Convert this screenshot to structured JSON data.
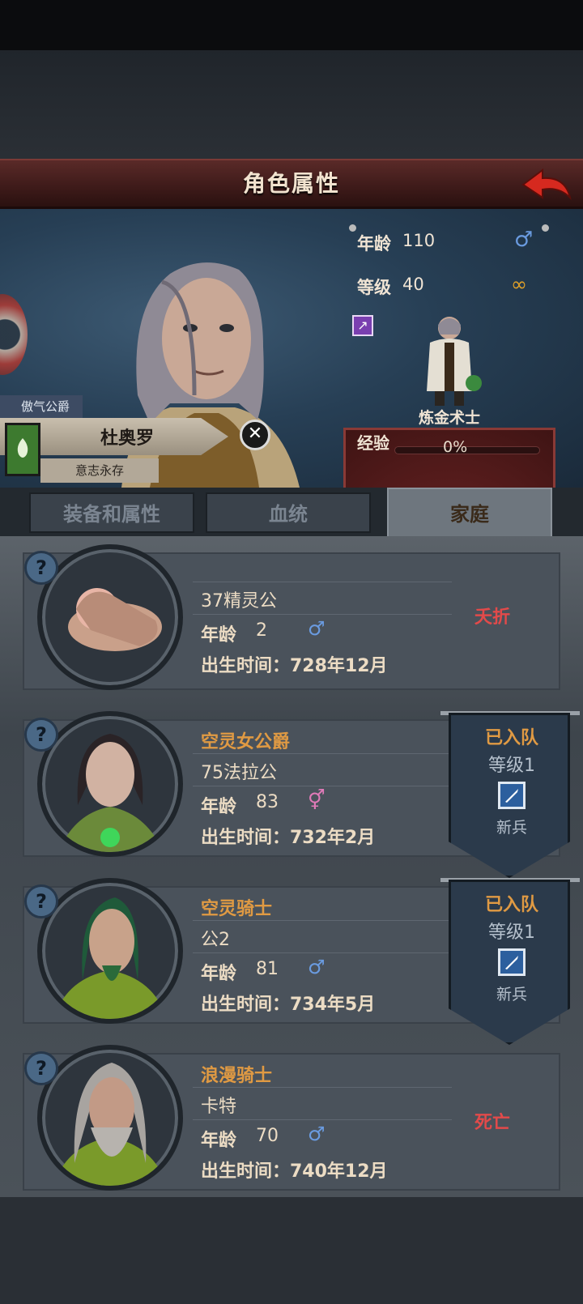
{
  "header": {
    "title": "角色属性"
  },
  "hero": {
    "title": "傲气公爵",
    "name": "杜奥罗",
    "motto": "意志永存"
  },
  "stats": {
    "age_label": "年龄",
    "age": "110",
    "level_label": "等级",
    "level": "40",
    "class_name": "炼金术士",
    "exp_label": "经验",
    "exp": "0%",
    "exp_fraction": 0
  },
  "tabs": [
    {
      "label": "装备和属性"
    },
    {
      "label": "血统"
    },
    {
      "label": "家庭"
    }
  ],
  "members": [
    {
      "title": "",
      "name": "37精灵公",
      "age_label": "年龄",
      "age": "2",
      "gender": "♂",
      "birth": "出生时间：728年12月",
      "status": "夭折"
    },
    {
      "title": "空灵女公爵",
      "name": "75法拉公",
      "age_label": "年龄",
      "age": "83",
      "gender": "⚥",
      "birth": "出生时间：732年2月",
      "pennant": {
        "joined": "已入队",
        "level": "等级1",
        "rank": "新兵"
      }
    },
    {
      "title": "空灵骑士",
      "name": "公2",
      "age_label": "年龄",
      "age": "81",
      "gender": "♂",
      "birth": "出生时间：734年5月",
      "pennant": {
        "joined": "已入队",
        "level": "等级1",
        "rank": "新兵"
      }
    },
    {
      "title": "浪漫骑士",
      "name": "卡特",
      "age_label": "年龄",
      "age": "70",
      "gender": "♂",
      "birth": "出生时间：740年12月",
      "status": "死亡"
    }
  ],
  "colors": {
    "header": "#4a2220",
    "panel": "#541b1b",
    "accent": "#e09a43",
    "status_red": "#e24a4a",
    "male": "#6a9be0",
    "female": "#e07ab8"
  }
}
